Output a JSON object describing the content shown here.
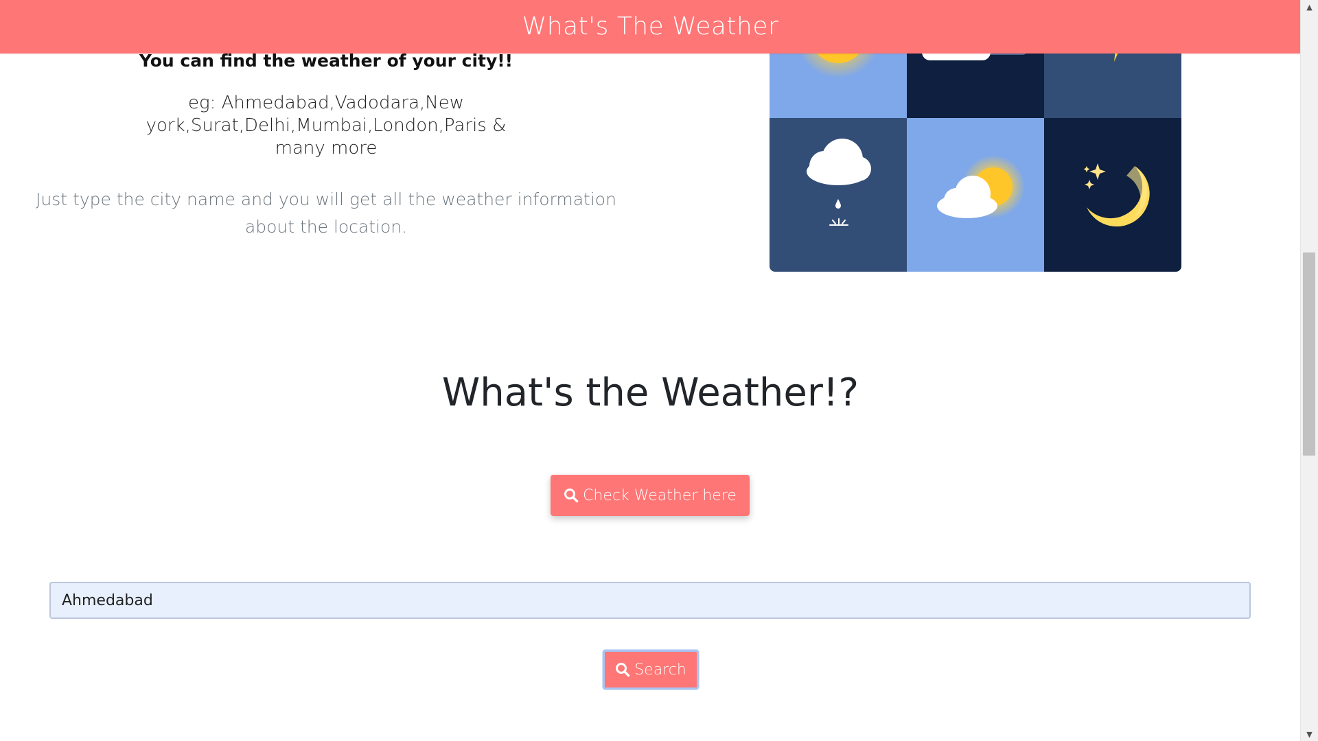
{
  "navbar": {
    "brand": "What's The Weather"
  },
  "intro": {
    "tagline": "You can find the weather of your city!!",
    "examples": "eg: Ahmedabad,Vadodara,New york,Surat,Delhi,Mumbai,London,Paris & many more",
    "note": "Just type the city name and you will get all the weather information about the location."
  },
  "illustration": {
    "tiles": [
      {
        "icon": "sun-icon",
        "background": "#7fa8ea"
      },
      {
        "icon": "cloud-icon",
        "background": "#0e1f3f"
      },
      {
        "icon": "lightning-icon",
        "background": "#324e76"
      },
      {
        "icon": "rain-cloud-icon",
        "background": "#324e76"
      },
      {
        "icon": "partly-cloudy-icon",
        "background": "#7fa8ea"
      },
      {
        "icon": "moon-stars-icon",
        "background": "#0e1f3f"
      }
    ]
  },
  "main": {
    "heading": "What's the Weather!?",
    "check_button": "Check Weather here",
    "city_input": {
      "value": "Ahmedabad",
      "placeholder": ""
    },
    "search_button": "Search"
  },
  "colors": {
    "accent": "#ff7676",
    "input_bg": "#e8f0fe"
  }
}
